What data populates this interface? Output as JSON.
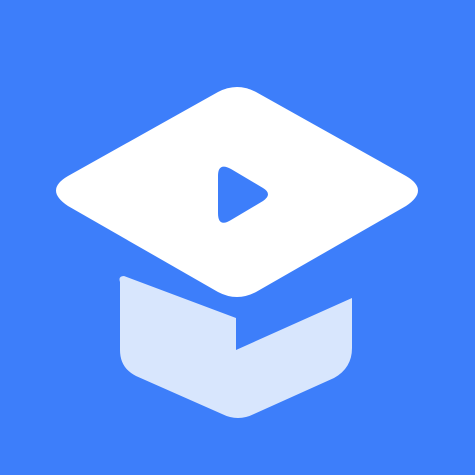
{
  "icon": {
    "semantic": "graduation-cap-play-icon",
    "colors": {
      "background": "#3d7efa",
      "cap_top": "#ffffff",
      "cap_base": "#d8e6fd",
      "play_triangle": "#3d7efa"
    }
  }
}
